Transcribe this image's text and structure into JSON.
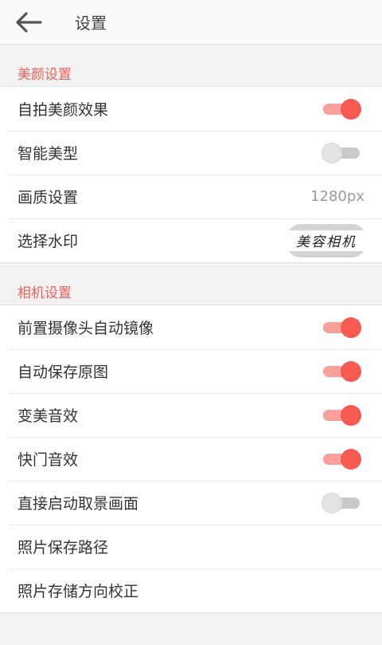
{
  "header": {
    "title": "设置"
  },
  "sections": [
    {
      "title": "美颜设置",
      "rows": [
        {
          "label": "自拍美颜效果",
          "type": "toggle",
          "on": true
        },
        {
          "label": "智能美型",
          "type": "toggle",
          "on": false
        },
        {
          "label": "画质设置",
          "type": "value",
          "value": "1280px"
        },
        {
          "label": "选择水印",
          "type": "watermark",
          "watermark_text": "美容相机"
        }
      ]
    },
    {
      "title": "相机设置",
      "rows": [
        {
          "label": "前置摄像头自动镜像",
          "type": "toggle",
          "on": true
        },
        {
          "label": "自动保存原图",
          "type": "toggle",
          "on": true
        },
        {
          "label": "变美音效",
          "type": "toggle",
          "on": true
        },
        {
          "label": "快门音效",
          "type": "toggle",
          "on": true
        },
        {
          "label": "直接启动取景画面",
          "type": "toggle",
          "on": false
        },
        {
          "label": "照片保存路径",
          "type": "link"
        },
        {
          "label": "照片存储方向校正",
          "type": "link"
        }
      ]
    }
  ],
  "colors": {
    "accent": "#f65a50",
    "track_on": "#f7a19a",
    "track_off": "#c9c9c9"
  }
}
